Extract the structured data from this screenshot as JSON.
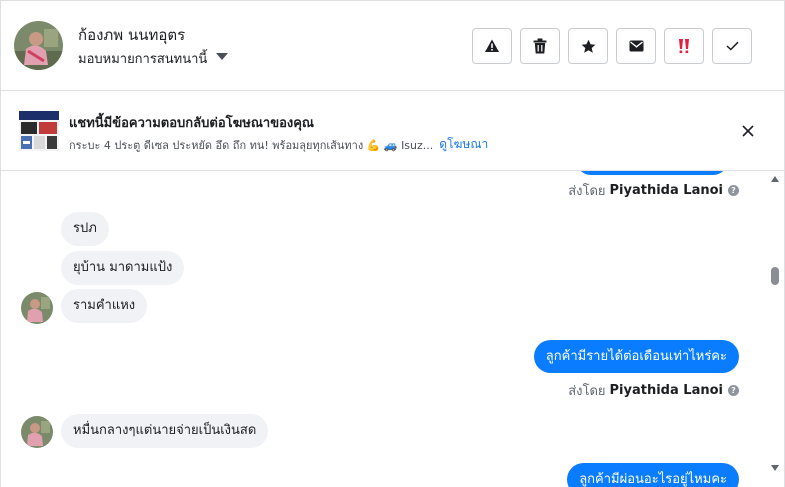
{
  "header": {
    "contact_name": "ก้องภพ นนทอุตร",
    "assign_label": "มอบหมายการสนทนานี้",
    "actions": [
      {
        "name": "spam",
        "icon": "warning-icon",
        "color": "#1c1e21"
      },
      {
        "name": "delete",
        "icon": "trash-icon",
        "color": "#1c1e21"
      },
      {
        "name": "star",
        "icon": "star-icon",
        "color": "#1c1e21"
      },
      {
        "name": "unread",
        "icon": "envelope-icon",
        "color": "#1c1e21"
      },
      {
        "name": "follow-up",
        "icon": "exclamation-flag-icon",
        "color": "#e41e3f"
      },
      {
        "name": "done",
        "icon": "check-icon",
        "color": "#1c1e21"
      }
    ]
  },
  "ad": {
    "title": "แชทนี้มีข้อความตอบกลับต่อโฆษณาของคุณ",
    "description": "กระบะ 4 ประตู ดีเซล ประหยัด อึด ถึก ทน! พร้อมลุยทุกเส้นทาง 💪 🚙 Isuz...",
    "view_ad_link": "ดูโฆษณา"
  },
  "messages": [
    {
      "type": "sent_by",
      "prefix": "ส่งโดย",
      "name": "Piyathida Lanoi"
    },
    {
      "type": "in",
      "text": "รปภ"
    },
    {
      "type": "in",
      "text": "ยุบ้าน มาดามแป้ง"
    },
    {
      "type": "in",
      "text": "รามคำแหง"
    },
    {
      "type": "out",
      "text": "ลูกค้ามีรายได้ต่อเดือนเท่าไหร่คะ"
    },
    {
      "type": "sent_by",
      "prefix": "ส่งโดย",
      "name": "Piyathida Lanoi"
    },
    {
      "type": "in",
      "text": "หมื่นกลางๆแต่นายจ่ายเป็นเงินสด"
    },
    {
      "type": "out",
      "text": "ลูกค้ามีผ่อนอะไรอยู่ไหมคะ"
    }
  ],
  "colors": {
    "outgoing_bubble": "#0a7cff",
    "incoming_bubble": "#f0f2f5",
    "link": "#1877f2",
    "border": "#dddfe2"
  }
}
